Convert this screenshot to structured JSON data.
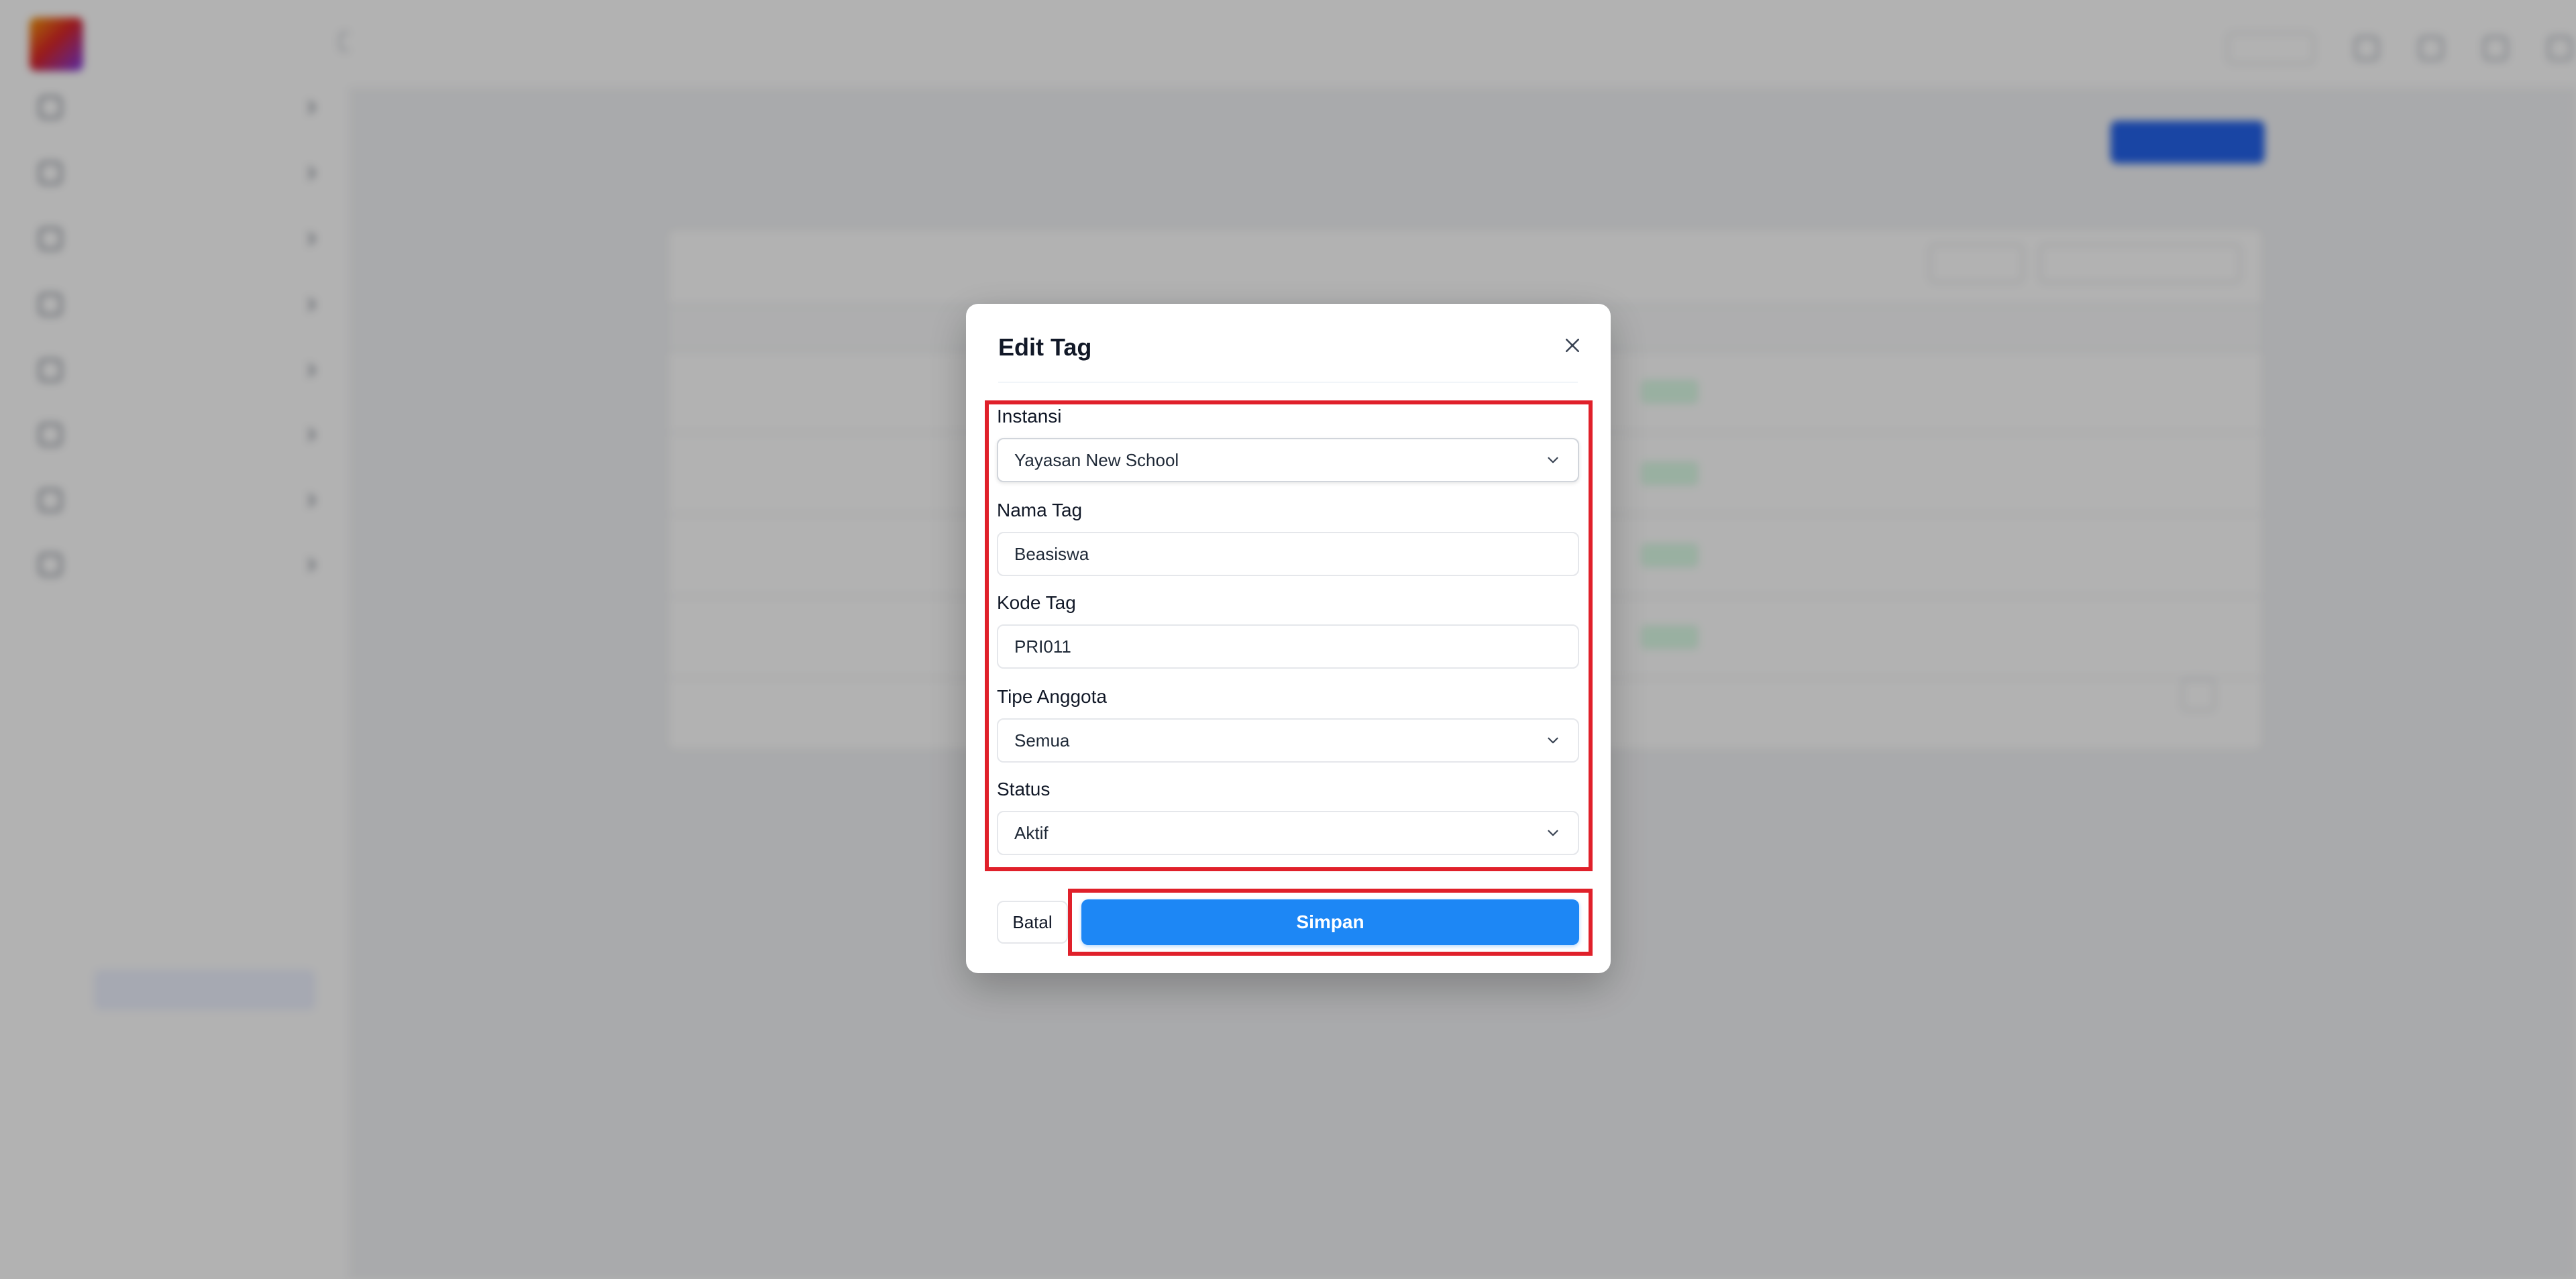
{
  "modal": {
    "title": "Edit Tag",
    "fields": {
      "instansi": {
        "label": "Instansi",
        "value": "Yayasan New School"
      },
      "nama_tag": {
        "label": "Nama Tag",
        "value": "Beasiswa"
      },
      "kode_tag": {
        "label": "Kode Tag",
        "value": "PRI011"
      },
      "tipe_anggota": {
        "label": "Tipe Anggota",
        "value": "Semua"
      },
      "status": {
        "label": "Status",
        "value": "Aktif"
      }
    },
    "cancel_label": "Batal",
    "save_label": "Simpan"
  },
  "icons": {
    "close": "close-icon",
    "chevron": "chevron-down-icon"
  },
  "colors": {
    "primary": "#1d87f5",
    "highlight": "#e0202a",
    "overlay": "rgba(0,0,0,0.30)"
  }
}
